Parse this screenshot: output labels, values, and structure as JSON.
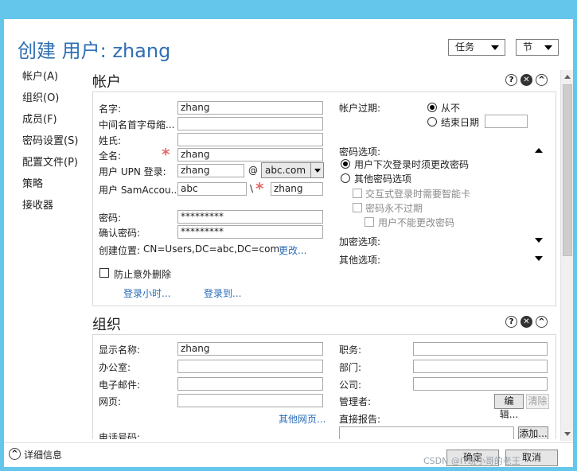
{
  "window": {
    "title": "创建 用户: zhang",
    "controls": {
      "minimize": "minimize",
      "maximize": "maximize",
      "close": "✕"
    }
  },
  "header": {
    "tasks_label": "任务",
    "section_label": "节"
  },
  "nav": {
    "items": [
      "帐户(A)",
      "组织(O)",
      "成员(F)",
      "密码设置(S)",
      "配置文件(P)",
      "策略",
      "接收器"
    ]
  },
  "account": {
    "title": "帐户",
    "icons": [
      "?",
      "✕",
      "^"
    ],
    "first_name_label": "名字:",
    "first_name_value": "zhang",
    "middle_initial_label": "中间名首字母缩...",
    "middle_initial_value": "",
    "last_name_label": "姓氏:",
    "last_name_value": "",
    "full_name_label": "全名:",
    "full_name_value": "zhang",
    "upn_label": "用户 UPN 登录:",
    "upn_value": "zhang",
    "at_sign": "@",
    "domain_value": "abc.com",
    "sam_label": "用户 SamAccou...",
    "sam_domain_value": "abc",
    "backslash": "\\",
    "sam_value": "zhang",
    "password_label": "密码:",
    "password_value": "*********",
    "confirm_label": "确认密码:",
    "confirm_value": "*********",
    "location_label": "创建位置:",
    "location_value": "CN=Users,DC=abc,DC=com",
    "change_link": "更改...",
    "protect_label": "防止意外删除",
    "logon_hours_link": "登录小时...",
    "logon_to_link": "登录到...",
    "expires_label": "帐户过期:",
    "never_label": "从不",
    "end_date_label": "结束日期",
    "end_date_value": "",
    "password_options_label": "密码选项:",
    "must_change_label": "用户下次登录时须更改密码",
    "other_options_label": "其他密码选项",
    "smartcard_label": "交互式登录时需要智能卡",
    "never_expires_label": "密码永不过期",
    "cannot_change_label": "用户不能更改密码",
    "encryption_label": "加密选项:",
    "other_label": "其他选项:"
  },
  "organization": {
    "title": "组织",
    "icons": [
      "?",
      "✕",
      "^"
    ],
    "display_name_label": "显示名称:",
    "display_name_value": "zhang",
    "office_label": "办公室:",
    "office_value": "",
    "email_label": "电子邮件:",
    "email_value": "",
    "web_label": "网页:",
    "web_value": "",
    "other_web_link": "其他网页...",
    "phone_label": "电话号码:",
    "job_title_label": "职务:",
    "job_title_value": "",
    "department_label": "部门:",
    "department_value": "",
    "company_label": "公司:",
    "company_value": "",
    "manager_label": "管理者:",
    "edit_button": "编辑...",
    "clear_button": "清除",
    "direct_reports_label": "直接报告:",
    "add_button": "添加..."
  },
  "footer": {
    "details_label": "详细信息",
    "ok_button": "确定",
    "cancel_button": "取消"
  },
  "watermark": "CSDN @IT班小哥的老王"
}
